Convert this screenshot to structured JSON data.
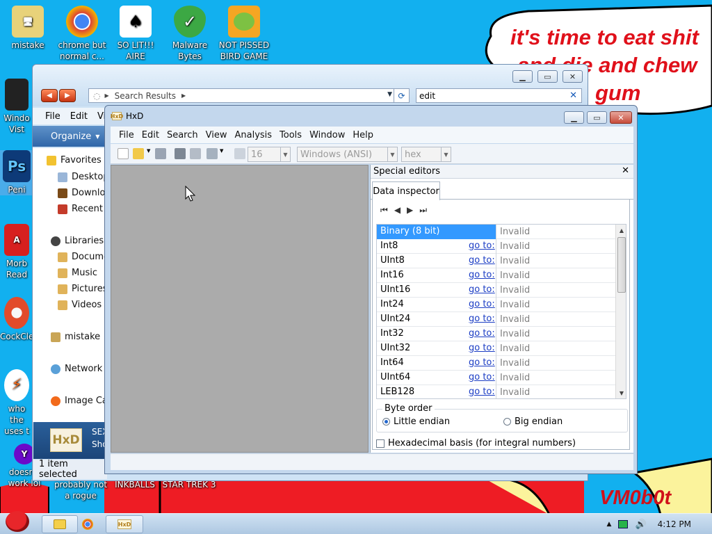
{
  "desktop": {
    "speech": [
      "it's time to eat shit",
      "and die and chew",
      "gum"
    ],
    "signature": "VM0b0t",
    "icons_top": [
      {
        "label": "mistake",
        "icon": "computer-icon"
      },
      {
        "label": "chrome but normal c...",
        "icon": "chrome-icon"
      },
      {
        "label": "SO LIT!!! AIRE",
        "icon": "solitaire-icon"
      },
      {
        "label": "Malware Bytes",
        "icon": "shield-icon"
      },
      {
        "label": "NOT PISSED BIRD GAME",
        "icon": "pig-icon"
      }
    ],
    "icons_left": [
      {
        "label": "Windo Vist",
        "icon": "trash-icon"
      },
      {
        "label": "Peni",
        "icon": "photoshop-icon"
      },
      {
        "label": "Morb Read",
        "icon": "pdf-icon"
      },
      {
        "label": "CockCle",
        "icon": "cleaner-icon"
      },
      {
        "label": "who the uses t",
        "icon": "flash-icon"
      },
      {
        "label": "doesn't work lol",
        "icon": "yahoo-icon"
      }
    ],
    "icons_bottom": [
      {
        "label": "probably not a rogue"
      },
      {
        "label": "INKBALLS"
      },
      {
        "label": "STAR TREK 3"
      }
    ]
  },
  "explorer": {
    "address": "Search Results",
    "search_value": "edit",
    "menu": [
      "File",
      "Edit",
      "Vi"
    ],
    "organize": "Organize",
    "nav": {
      "favorites": "Favorites",
      "desktop": "Desktop",
      "downloads": "Downlo",
      "recent": "Recent",
      "libraries": "Libraries",
      "documents": "Docume",
      "music": "Music",
      "pictures": "Pictures",
      "videos": "Videos",
      "mistake": "mistake",
      "network": "Network",
      "imagecap": "Image Ca"
    },
    "detail_logo": "HxD",
    "detail_line1": "SEX",
    "detail_line2": "Sho",
    "status": "1 item selected"
  },
  "hxd": {
    "title": "HxD",
    "menu": [
      "File",
      "Edit",
      "Search",
      "View",
      "Analysis",
      "Tools",
      "Window",
      "Help"
    ],
    "bytes_per_row": "16",
    "charset": "Windows (ANSI)",
    "offset_base": "hex",
    "side_title": "Special editors",
    "tab": "Data inspector",
    "goto_label": "go to:",
    "invalid": "Invalid",
    "rows": [
      {
        "name": "Binary (8 bit)",
        "goto": false,
        "value": "Invalid",
        "selected": true
      },
      {
        "name": "Int8",
        "goto": true,
        "value": "Invalid"
      },
      {
        "name": "UInt8",
        "goto": true,
        "value": "Invalid"
      },
      {
        "name": "Int16",
        "goto": true,
        "value": "Invalid"
      },
      {
        "name": "UInt16",
        "goto": true,
        "value": "Invalid"
      },
      {
        "name": "Int24",
        "goto": true,
        "value": "Invalid"
      },
      {
        "name": "UInt24",
        "goto": true,
        "value": "Invalid"
      },
      {
        "name": "Int32",
        "goto": true,
        "value": "Invalid"
      },
      {
        "name": "UInt32",
        "goto": true,
        "value": "Invalid"
      },
      {
        "name": "Int64",
        "goto": true,
        "value": "Invalid"
      },
      {
        "name": "UInt64",
        "goto": true,
        "value": "Invalid"
      },
      {
        "name": "LEB128",
        "goto": true,
        "value": "Invalid"
      }
    ],
    "byte_order_label": "Byte order",
    "little_endian": "Little endian",
    "big_endian": "Big endian",
    "hex_basis": "Hexadecimal basis (for integral numbers)"
  },
  "taskbar": {
    "clock": "4:12 PM"
  }
}
